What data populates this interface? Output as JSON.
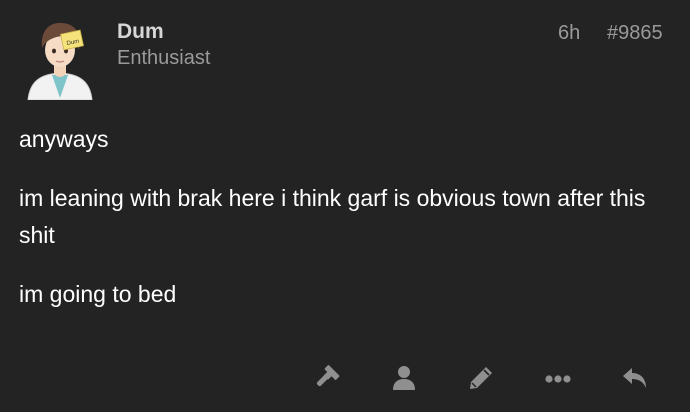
{
  "post": {
    "username": "Dum",
    "user_title": "Enthusiast",
    "age": "6h",
    "post_number": "#9865",
    "avatar_badge": "Dum",
    "paragraphs": [
      "anyways",
      "im leaning with brak here i think garf is obvious town after this shit",
      "im going to bed"
    ]
  },
  "actions": [
    {
      "icon": "gavel-icon"
    },
    {
      "icon": "user-icon"
    },
    {
      "icon": "pencil-icon"
    },
    {
      "icon": "ellipsis-icon"
    },
    {
      "icon": "reply-icon"
    }
  ],
  "colors": {
    "background": "#232323",
    "text": "#ffffff",
    "muted": "#9a9a9a",
    "icon": "#8f8f8f"
  }
}
